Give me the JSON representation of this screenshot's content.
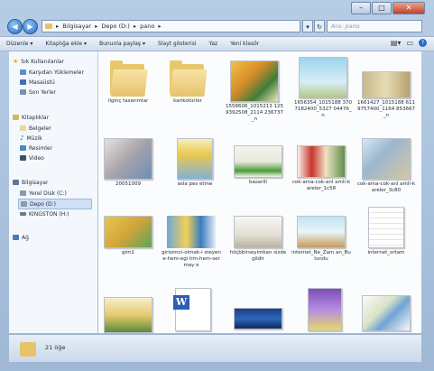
{
  "address": {
    "parts": [
      "Bilgisayar",
      "Depo (D:)",
      "pano"
    ]
  },
  "search": {
    "placeholder": "Ara: pano"
  },
  "toolbar": {
    "items": [
      "Düzenle ▾",
      "Kitaplığa ekle ▾",
      "Bununla paylaş ▾",
      "Slayt gösterisi",
      "Yaz",
      "Yeni klasör"
    ]
  },
  "nav": {
    "favorites": {
      "title": "Sık Kullanılanlar",
      "items": [
        "Karşıdan Yüklemeler",
        "Masaüstü",
        "Son Yerler"
      ]
    },
    "libraries": {
      "title": "Kitaplıklar",
      "items": [
        "Belgeler",
        "Müzik",
        "Resimler",
        "Video"
      ]
    },
    "computer": {
      "title": "Bilgisayar",
      "items": [
        "Yerel Disk (C:)",
        "Depo (D:)",
        "KINGSTON (H:)"
      ]
    },
    "network": {
      "title": "Ağ"
    }
  },
  "files": [
    {
      "name": "ilginç tasarımlar"
    },
    {
      "name": "karikotürler"
    },
    {
      "name": "1558606_1015213 1259392508_2114 236737_n"
    },
    {
      "name": "1656354_1015188 3707182400_5327 04476_n"
    },
    {
      "name": "1661427_1015188 6119757400_1164 853667_n"
    },
    {
      "name": "20051009"
    },
    {
      "name": "asla pes etme"
    },
    {
      "name": "basarili"
    },
    {
      "name": "cok-ama-cok-anl amli-kareler_1c58"
    },
    {
      "name": "cok-ama-cok-anl amli-kareler_3c80"
    },
    {
      "name": "gim1"
    },
    {
      "name": "girisimci-olmak-i steyene-hem-egi tim-hem-sermay e"
    },
    {
      "name": "hiiçbbirseyimkan sizdegildir"
    },
    {
      "name": "internet_Ne_Zam an_Bulundu"
    },
    {
      "name": "internet_ortam"
    },
    {
      "name": ""
    },
    {
      "name": ""
    },
    {
      "name": ""
    },
    {
      "name": ""
    },
    {
      "name": ""
    }
  ],
  "status": {
    "count": "21 öğe"
  }
}
